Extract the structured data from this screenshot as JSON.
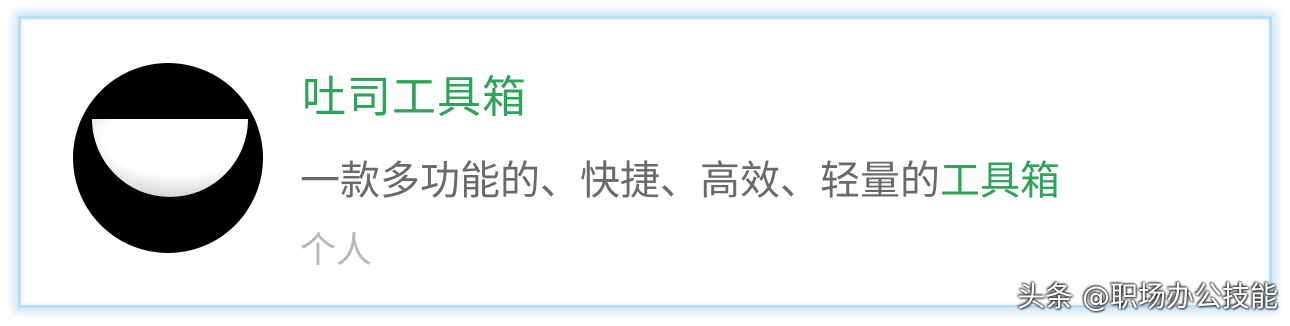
{
  "account": {
    "name": "吐司工具箱",
    "description": "一款多功能的、快捷、高效、轻量的",
    "description_highlight": "工具箱",
    "type": "个人",
    "avatar_icon": "smile-logo-icon"
  },
  "watermark": {
    "text": "头条 @职场办公技能"
  },
  "colors": {
    "title_green": "#2fa35a",
    "description_gray": "#6a6a6a",
    "type_gray": "#b7b7b7",
    "card_border_blue": "#b9dcf6"
  }
}
